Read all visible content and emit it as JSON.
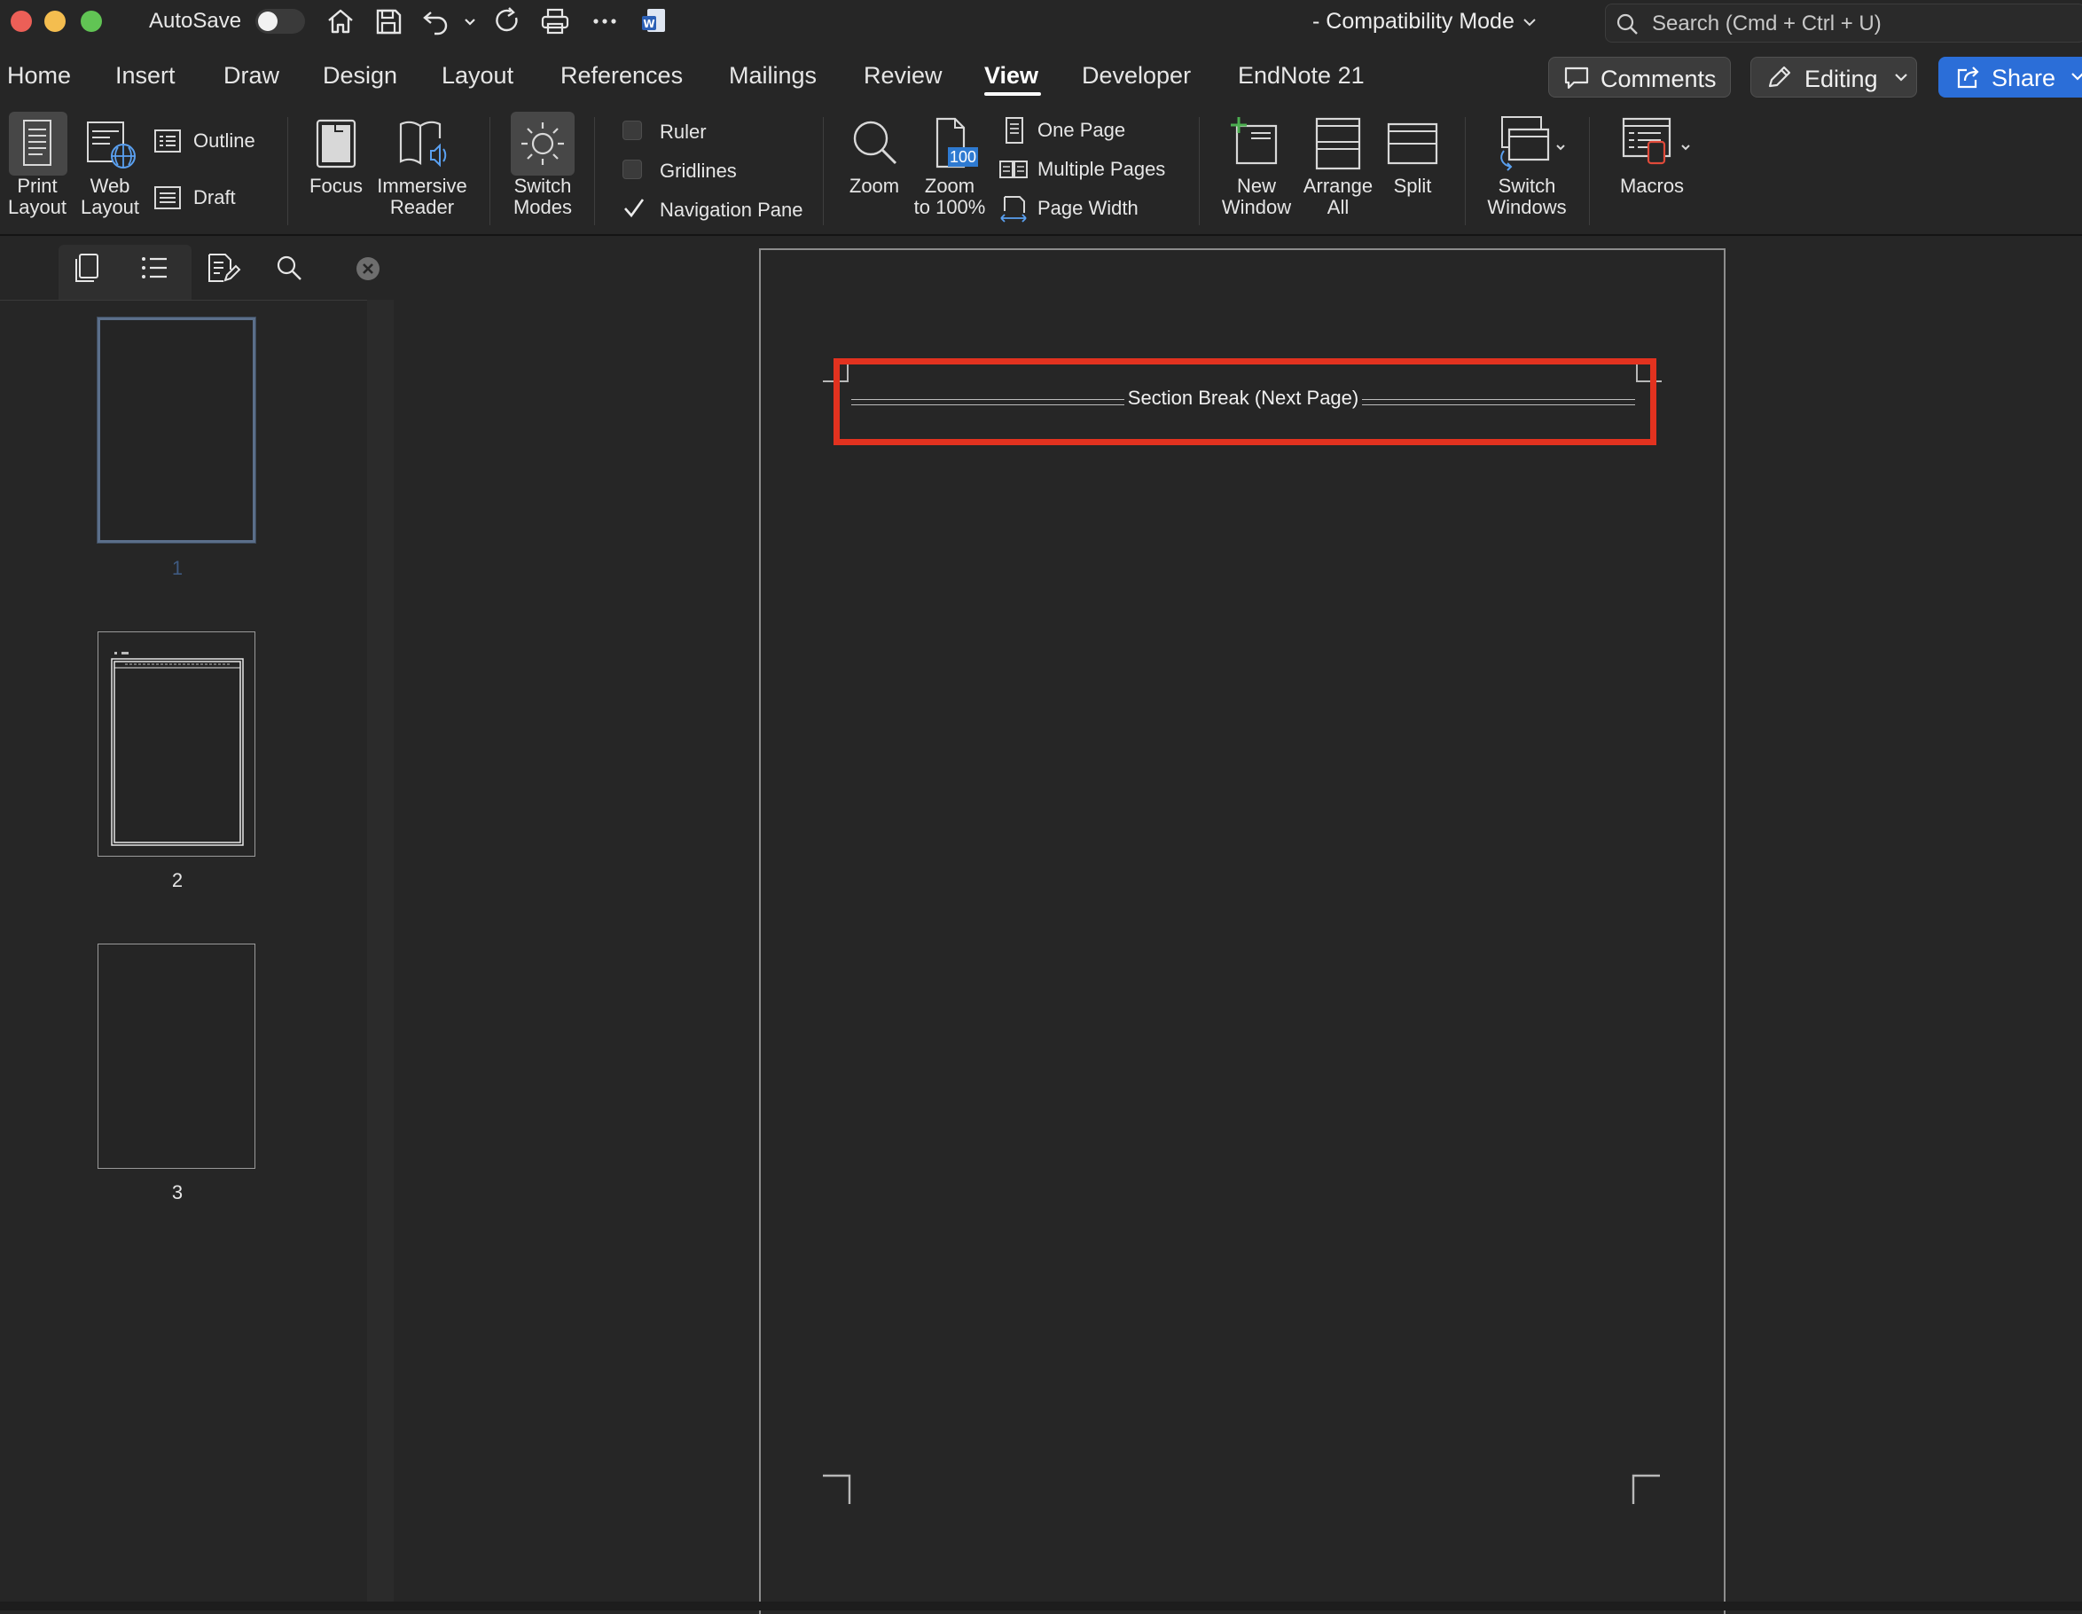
{
  "titlebar": {
    "autosave_label": "AutoSave",
    "autosave_on": false,
    "compat_text": "-  Compatibility Mode",
    "search_placeholder": "Search (Cmd + Ctrl + U)"
  },
  "tabs": [
    {
      "label": "Home"
    },
    {
      "label": "Insert"
    },
    {
      "label": "Draw"
    },
    {
      "label": "Design"
    },
    {
      "label": "Layout"
    },
    {
      "label": "References"
    },
    {
      "label": "Mailings"
    },
    {
      "label": "Review"
    },
    {
      "label": "View",
      "active": true
    },
    {
      "label": "Developer"
    },
    {
      "label": "EndNote 21"
    }
  ],
  "top_buttons": {
    "comments": "Comments",
    "editing": "Editing",
    "share": "Share"
  },
  "ribbon": {
    "views": {
      "print_layout_1": "Print",
      "print_layout_2": "Layout",
      "web_layout_1": "Web",
      "web_layout_2": "Layout",
      "outline": "Outline",
      "draft": "Draft"
    },
    "immersive": {
      "focus": "Focus",
      "immersive_1": "Immersive",
      "immersive_2": "Reader"
    },
    "switch_modes_1": "Switch",
    "switch_modes_2": "Modes",
    "show": {
      "ruler": "Ruler",
      "ruler_checked": false,
      "gridlines": "Gridlines",
      "gridlines_checked": false,
      "navigation_pane": "Navigation Pane",
      "navigation_pane_checked": true
    },
    "zoom": {
      "zoom": "Zoom",
      "zoom100_1": "Zoom",
      "zoom100_2": "to 100%",
      "zoom100_badge": "100",
      "one_page": "One Page",
      "multiple_pages": "Multiple Pages",
      "page_width": "Page Width"
    },
    "window": {
      "new_window_1": "New",
      "new_window_2": "Window",
      "arrange_1": "Arrange",
      "arrange_2": "All",
      "split": "Split",
      "switch_windows_1": "Switch",
      "switch_windows_2": "Windows"
    },
    "macros": "Macros"
  },
  "nav": {
    "pages": [
      {
        "number": "1",
        "selected": true
      },
      {
        "number": "2"
      },
      {
        "number": "3"
      }
    ]
  },
  "document": {
    "section_break": "Section Break (Next Page)"
  },
  "colors": {
    "background": "#262626",
    "share_blue": "#2b6ed8",
    "highlight_red": "#e2321f"
  }
}
